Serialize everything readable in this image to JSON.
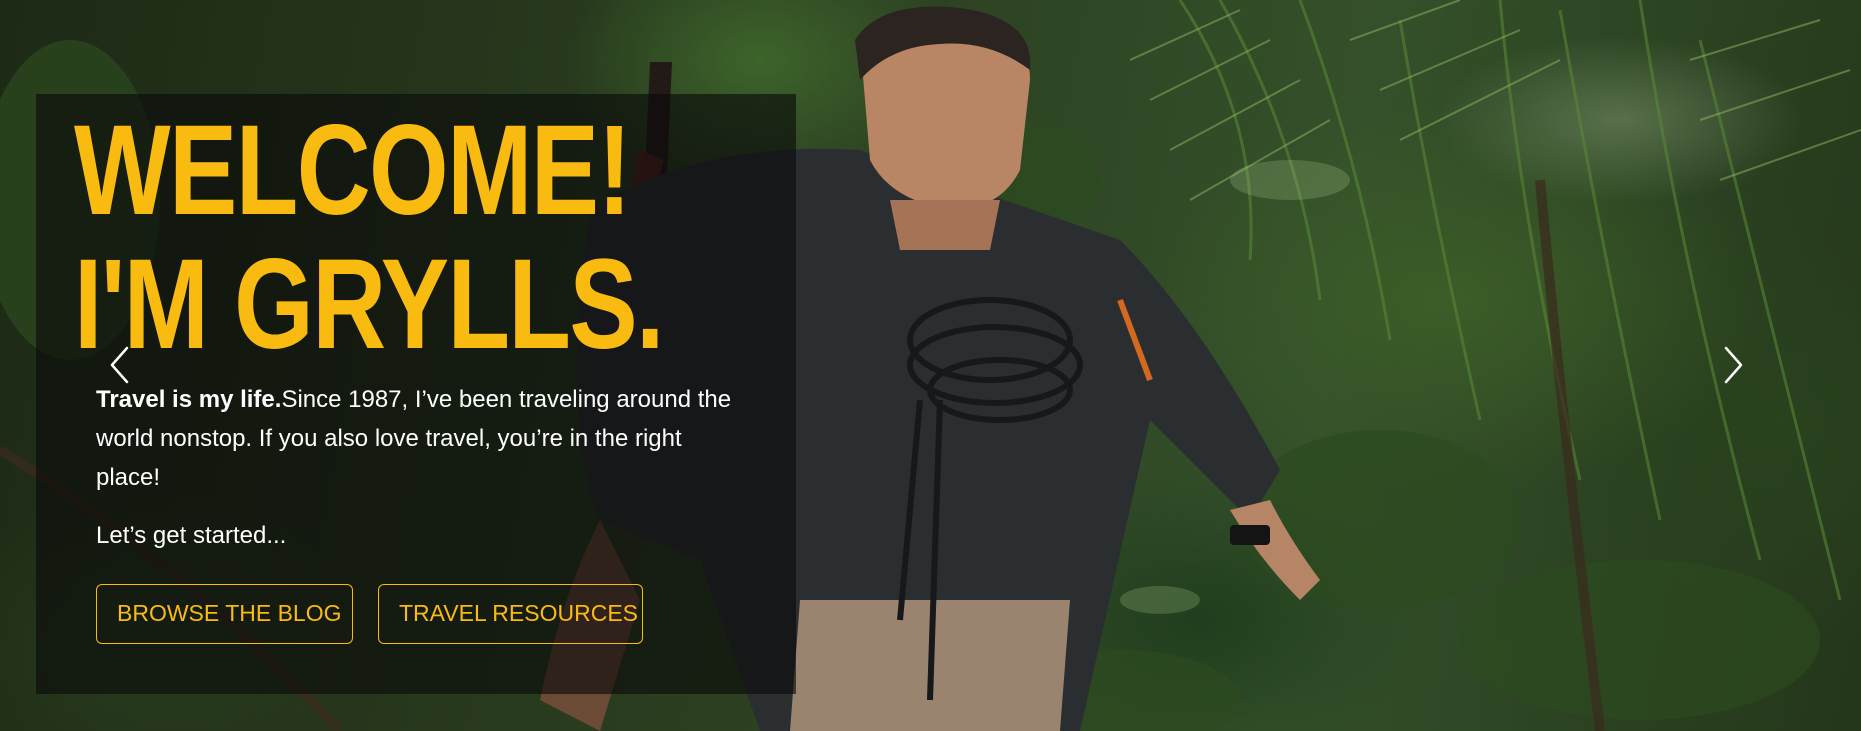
{
  "hero": {
    "headline_line1": "WELCOME!",
    "headline_line2": "I'M GRYLLS.",
    "intro_bold": "Travel is my life.",
    "intro_text": "Since 1987, I’ve been traveling around the world nonstop. If you also love travel, you’re in the right place!",
    "cta_text": "Let’s get started...",
    "buttons": {
      "blog_label": "BROWSE THE BLOG",
      "resources_label": "TRAVEL RESOURCES"
    },
    "carousel": {
      "prev_icon": "chevron-left-icon",
      "next_icon": "chevron-right-icon"
    }
  },
  "colors": {
    "accent": "#f9bb10",
    "panel": "rgba(10,10,10,0.62)",
    "text": "#ffffff"
  }
}
